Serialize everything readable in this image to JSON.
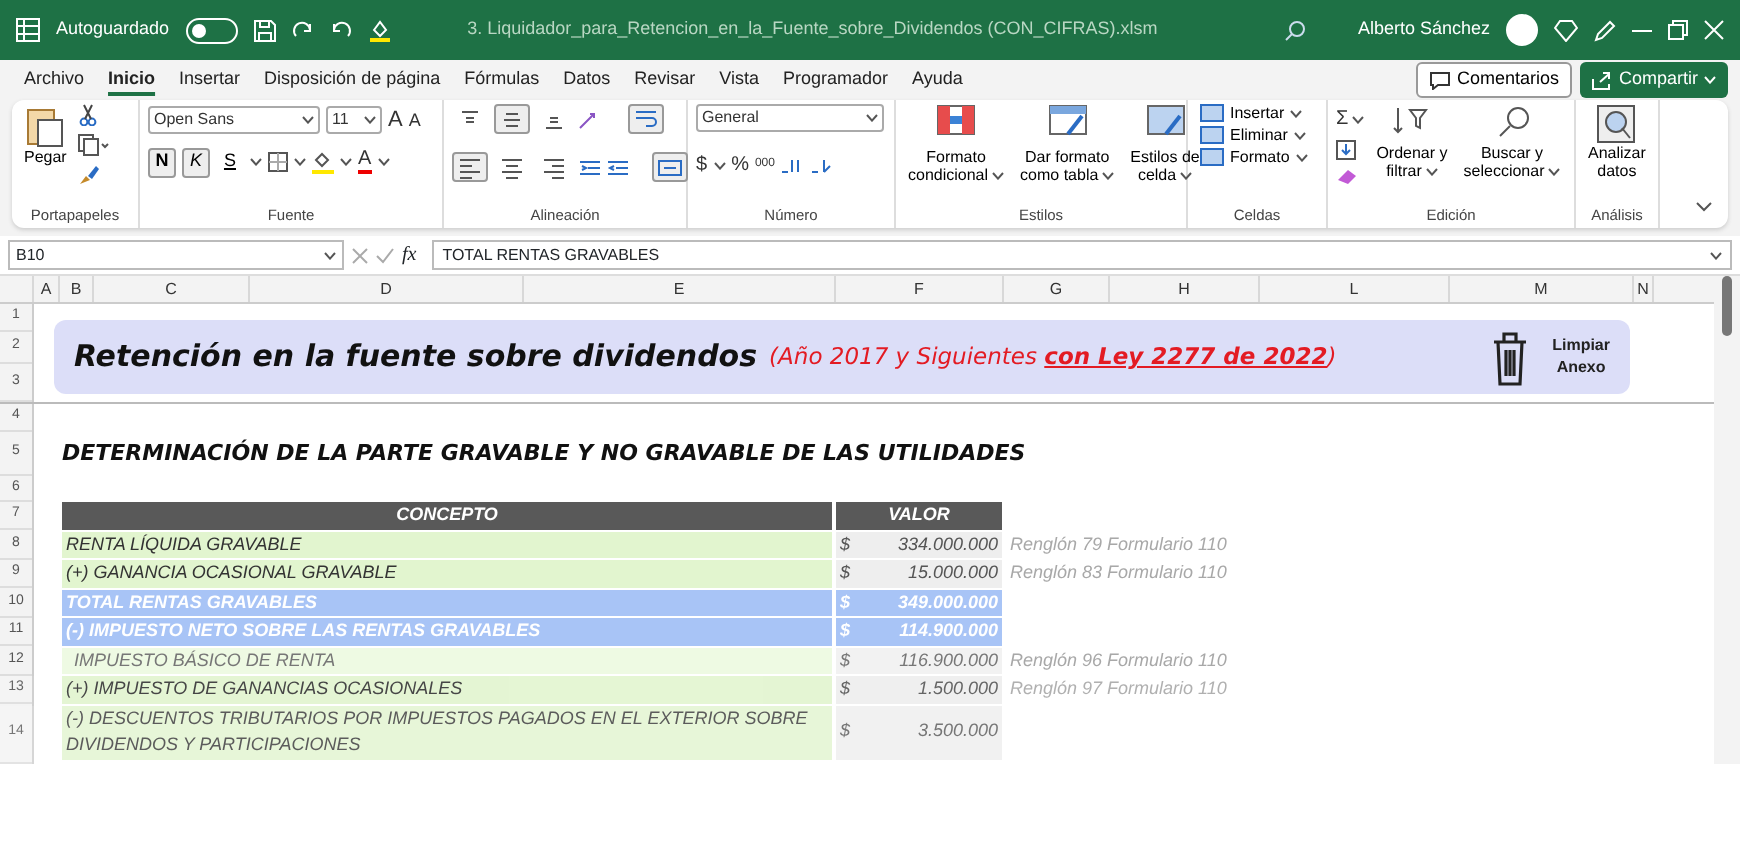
{
  "title_bar": {
    "autosave_label": "Autoguardado",
    "autosave_on": false,
    "filename": "3. Liquidador_para_Retencion_en_la_Fuente_sobre_Dividendos (CON_CIFRAS).xlsm",
    "user": "Alberto Sánchez"
  },
  "menu_tabs": [
    {
      "label": "Archivo",
      "selected": false
    },
    {
      "label": "Inicio",
      "selected": true
    },
    {
      "label": "Insertar",
      "selected": false
    },
    {
      "label": "Disposición de página",
      "selected": false
    },
    {
      "label": "Fórmulas",
      "selected": false
    },
    {
      "label": "Datos",
      "selected": false
    },
    {
      "label": "Revisar",
      "selected": false
    },
    {
      "label": "Vista",
      "selected": false
    },
    {
      "label": "Programador",
      "selected": false
    },
    {
      "label": "Ayuda",
      "selected": false
    }
  ],
  "comments_button": "Comentarios",
  "share_button": "Compartir",
  "ribbon": {
    "clipboard": {
      "paste": "Pegar",
      "label": "Portapapeles"
    },
    "font": {
      "name": "Open Sans",
      "size": "11",
      "grow": "A",
      "shrink": "A",
      "bold": {
        "label": "N",
        "on": true
      },
      "italic": {
        "label": "K",
        "on": true
      },
      "underline": "S",
      "color_letter": "A",
      "label": "Fuente"
    },
    "alignment": {
      "top_row": [
        {
          "kind": "top",
          "selected": false
        },
        {
          "kind": "middle",
          "selected": true
        },
        {
          "kind": "bottom",
          "selected": false
        }
      ],
      "bottom_row": [
        {
          "kind": "left",
          "selected": true
        },
        {
          "kind": "center",
          "selected": false
        },
        {
          "kind": "right",
          "selected": false
        }
      ],
      "label": "Alineación"
    },
    "number": {
      "format": "General",
      "currency": "$",
      "percent": "%",
      "thousands": "000",
      "label": "Número"
    },
    "styles": {
      "buttons": [
        {
          "lines": [
            "Formato",
            "condicional"
          ]
        },
        {
          "lines": [
            "Dar formato",
            "como tabla"
          ]
        },
        {
          "lines": [
            "Estilos de",
            "celda"
          ]
        }
      ],
      "label": "Estilos"
    },
    "cells": {
      "buttons": [
        "Insertar",
        "Eliminar",
        "Formato"
      ],
      "label": "Celdas"
    },
    "editing": {
      "sum": "Σ",
      "buttons": [
        {
          "lines": [
            "Ordenar y",
            "filtrar"
          ]
        },
        {
          "lines": [
            "Buscar y",
            "seleccionar"
          ]
        }
      ],
      "label": "Edición"
    },
    "analysis": {
      "button": [
        "Analizar",
        "datos"
      ],
      "label": "Análisis"
    }
  },
  "formula_bar": {
    "name_box": "B10",
    "fx": "fx",
    "content": "TOTAL RENTAS GRAVABLES"
  },
  "columns": [
    "A",
    "B",
    "C",
    "D",
    "E",
    "F",
    "G",
    "H",
    "L",
    "M",
    "N"
  ],
  "banner": {
    "title": "Retención en la fuente sobre dividendos",
    "subtitle_prefix": "(Año 2017 y Siguientes ",
    "subtitle_law": "con Ley 2277 de 2022",
    "subtitle_suffix": ")",
    "clear_button": [
      "Limpiar",
      "Anexo"
    ]
  },
  "heading": "DETERMINACIÓN DE LA PARTE GRAVABLE Y NO GRAVABLE DE LAS UTILIDADES",
  "table": {
    "columns": [
      "CONCEPTO",
      "VALOR"
    ],
    "rows": [
      {
        "row": "8",
        "kind": "input",
        "concept": "RENTA LÍQUIDA GRAVABLE",
        "currency": "$",
        "value": "334.000.000",
        "note": "Renglón 79 Formulario 110"
      },
      {
        "row": "9",
        "kind": "input",
        "concept": "(+) GANANCIA OCASIONAL GRAVABLE",
        "currency": "$",
        "value": "15.000.000",
        "note": "Renglón 83 Formulario 110"
      },
      {
        "row": "10",
        "kind": "total",
        "concept": "TOTAL RENTAS GRAVABLES",
        "currency": "$",
        "value": "349.000.000"
      },
      {
        "row": "11",
        "kind": "total",
        "concept": "(-) IMPUESTO NETO SOBRE LAS RENTAS GRAVABLES",
        "currency": "$",
        "value": "114.900.000"
      },
      {
        "row": "12",
        "kind": "sub",
        "concept": "IMPUESTO BÁSICO DE RENTA",
        "currency": "$",
        "value": "116.900.000",
        "note": "Renglón 96 Formulario 110"
      },
      {
        "row": "13",
        "kind": "input",
        "concept": "(+) IMPUESTO DE GANANCIAS OCASIONALES",
        "currency": "$",
        "value": "1.500.000",
        "note": "Renglón 97 Formulario 110"
      },
      {
        "row": "14",
        "kind": "input",
        "concept": "(-) DESCUENTOS TRIBUTARIOS POR IMPUESTOS PAGADOS EN EL EXTERIOR SOBRE DIVIDENDOS Y PARTICIPACIONES",
        "currency": "$",
        "value": "3.500.000"
      }
    ]
  },
  "row_numbers": [
    "1",
    "2",
    "3",
    "4",
    "5",
    "6",
    "7"
  ]
}
